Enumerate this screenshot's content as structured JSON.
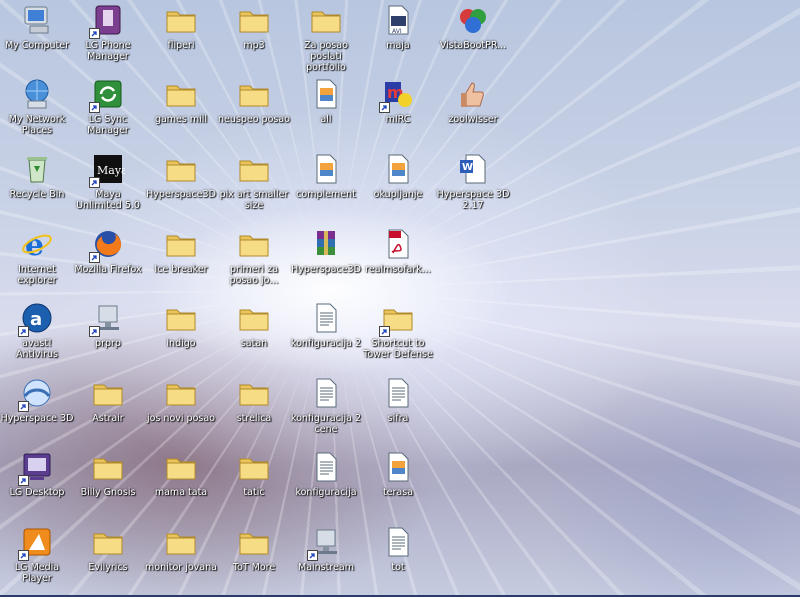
{
  "desktop": {
    "icons": [
      {
        "label": "My Computer",
        "icon": "computer"
      },
      {
        "label": "LG Phone Manager",
        "icon": "lg-phone"
      },
      {
        "label": "fliperi",
        "icon": "folder"
      },
      {
        "label": "mp3",
        "icon": "folder"
      },
      {
        "label": "Za posao poslati portfolio",
        "icon": "folder"
      },
      {
        "label": "maja",
        "icon": "avi-file"
      },
      {
        "label": "VistaBootPR...",
        "icon": "vistaboot"
      },
      {
        "label": "My Network Places",
        "icon": "network"
      },
      {
        "label": "LG Sync Manager",
        "icon": "lg-sync"
      },
      {
        "label": "games mill",
        "icon": "folder"
      },
      {
        "label": "neuspeo posao",
        "icon": "folder"
      },
      {
        "label": "all",
        "icon": "image-file"
      },
      {
        "label": "mIRC",
        "icon": "mirc"
      },
      {
        "label": "zoolwisser",
        "icon": "thumbs"
      },
      {
        "label": "Recycle Bin",
        "icon": "recycle-bin"
      },
      {
        "label": "Maya Unlimited 5.0",
        "icon": "maya"
      },
      {
        "label": "Hyperspace3D",
        "icon": "folder"
      },
      {
        "label": "pix art smaller size",
        "icon": "folder"
      },
      {
        "label": "complement",
        "icon": "image-file"
      },
      {
        "label": "okupljanje",
        "icon": "image-file"
      },
      {
        "label": "Hyperspace 3D 2.17",
        "icon": "word-doc"
      },
      {
        "label": "Internet explorer",
        "icon": "ie"
      },
      {
        "label": "Mozilla Firefox",
        "icon": "firefox"
      },
      {
        "label": "Ice breaker",
        "icon": "folder"
      },
      {
        "label": "primeri za posao jo...",
        "icon": "folder"
      },
      {
        "label": "Hyperspace3D",
        "icon": "winrar"
      },
      {
        "label": "realmsofark...",
        "icon": "pdf"
      },
      {
        "label": "avast! Antivirus",
        "icon": "avast"
      },
      {
        "label": "prprp",
        "icon": "network-share"
      },
      {
        "label": "indigo",
        "icon": "folder"
      },
      {
        "label": "satan",
        "icon": "folder"
      },
      {
        "label": "konfiguracija 2",
        "icon": "text-file"
      },
      {
        "label": "Shortcut to Tower Defense",
        "icon": "folder"
      },
      {
        "label": "Hyperspace 3D",
        "icon": "hyperspace"
      },
      {
        "label": "Astrair",
        "icon": "folder"
      },
      {
        "label": "jos novi posao",
        "icon": "folder"
      },
      {
        "label": "strelica",
        "icon": "folder"
      },
      {
        "label": "konfiguracija 2 cene",
        "icon": "text-file"
      },
      {
        "label": "sifra",
        "icon": "text-file"
      },
      {
        "label": "LG Desktop",
        "icon": "lg-desktop"
      },
      {
        "label": "Billy Gnosis",
        "icon": "folder"
      },
      {
        "label": "mama tata",
        "icon": "folder"
      },
      {
        "label": "tatic",
        "icon": "folder"
      },
      {
        "label": "konfiguracija",
        "icon": "text-file"
      },
      {
        "label": "terasa",
        "icon": "image-file"
      },
      {
        "label": "LG Media Player",
        "icon": "lg-media"
      },
      {
        "label": "Evilyrics",
        "icon": "folder"
      },
      {
        "label": "monitor jovana",
        "icon": "folder"
      },
      {
        "label": "ToT More",
        "icon": "folder"
      },
      {
        "label": "Mainstream",
        "icon": "network-share"
      },
      {
        "label": "tot",
        "icon": "text-file"
      }
    ]
  }
}
